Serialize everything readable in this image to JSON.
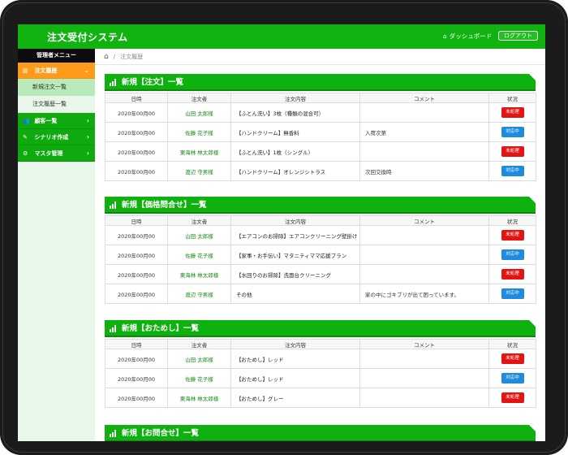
{
  "header": {
    "title": "注文受付システム",
    "dashboard_label": "ダッシュボード",
    "logout_label": "ログアウト"
  },
  "sidebar": {
    "heading": "管理者メニュー",
    "items": [
      {
        "label": "注文履歴",
        "icon": "bar-chart-icon",
        "active": true,
        "subitems": [
          "新規注文一覧",
          "注文履歴一覧"
        ]
      },
      {
        "label": "顧客一覧",
        "icon": "users-icon"
      },
      {
        "label": "シナリオ作成",
        "icon": "pencil-icon"
      },
      {
        "label": "マスタ管理",
        "icon": "gear-icon"
      }
    ]
  },
  "breadcrumb": {
    "current": "注文履歴"
  },
  "columns": [
    "日時",
    "注文者",
    "注文内容",
    "コメント",
    "状況"
  ],
  "status_labels": {
    "pending": "未処理",
    "in_progress": "対応中"
  },
  "colors": {
    "brand_green": "#0eb10e",
    "accent_orange": "#ff9a1a",
    "status_red": "#e31414",
    "status_blue": "#1e8bde"
  },
  "panels": [
    {
      "title": "新規【注文】一覧",
      "rows": [
        {
          "date": "2020年00月00",
          "name": "山田 太郎様",
          "content": "【ふとん洗い】3枚（種類の混合可）",
          "comment": "",
          "status": "未処理",
          "status_color": "red"
        },
        {
          "date": "2020年00月00",
          "name": "佐藤 花子様",
          "content": "【ハンドクリーム】無香料",
          "comment": "入荷次第",
          "status": "対応中",
          "status_color": "blue"
        },
        {
          "date": "2020年00月00",
          "name": "東海林 林太郎様",
          "content": "【ふとん洗い】1枚（シングル）",
          "comment": "",
          "status": "未処理",
          "status_color": "red"
        },
        {
          "date": "2020年00月00",
          "name": "渡辺 守男様",
          "content": "【ハンドクリーム】オレンジシトラス",
          "comment": "次回交換時",
          "status": "対応中",
          "status_color": "blue"
        }
      ]
    },
    {
      "title": "新規【価格問合せ】一覧",
      "rows": [
        {
          "date": "2020年00月00",
          "name": "山田 太郎様",
          "content": "【エアコンのお掃除】エアコンクリーニング壁掛け",
          "comment": "",
          "status": "未処理",
          "status_color": "red"
        },
        {
          "date": "2020年00月00",
          "name": "佐藤 花子様",
          "content": "【家事・お手伝い】マタニティママ応援プラン",
          "comment": "",
          "status": "対応中",
          "status_color": "blue"
        },
        {
          "date": "2020年00月00",
          "name": "東海林 林太郎様",
          "content": "【水回りのお掃除】洗面台クリーニング",
          "comment": "",
          "status": "未処理",
          "status_color": "red"
        },
        {
          "date": "2020年00月00",
          "name": "渡辺 守男様",
          "content": "その他",
          "comment": "家の中にゴキブリが出て困っています。",
          "status": "対応中",
          "status_color": "blue"
        }
      ]
    },
    {
      "title": "新規【おためし】一覧",
      "rows": [
        {
          "date": "2020年00月00",
          "name": "山田 太郎様",
          "content": "【おためし】レッド",
          "comment": "",
          "status": "未処理",
          "status_color": "red"
        },
        {
          "date": "2020年00月00",
          "name": "佐藤 花子様",
          "content": "【おためし】レッド",
          "comment": "",
          "status": "対応中",
          "status_color": "blue"
        },
        {
          "date": "2020年00月00",
          "name": "東海林 林太郎様",
          "content": "【おためし】グレー",
          "comment": "",
          "status": "未処理",
          "status_color": "red"
        }
      ]
    },
    {
      "title": "新規【お問合せ】一覧",
      "rows": []
    }
  ]
}
